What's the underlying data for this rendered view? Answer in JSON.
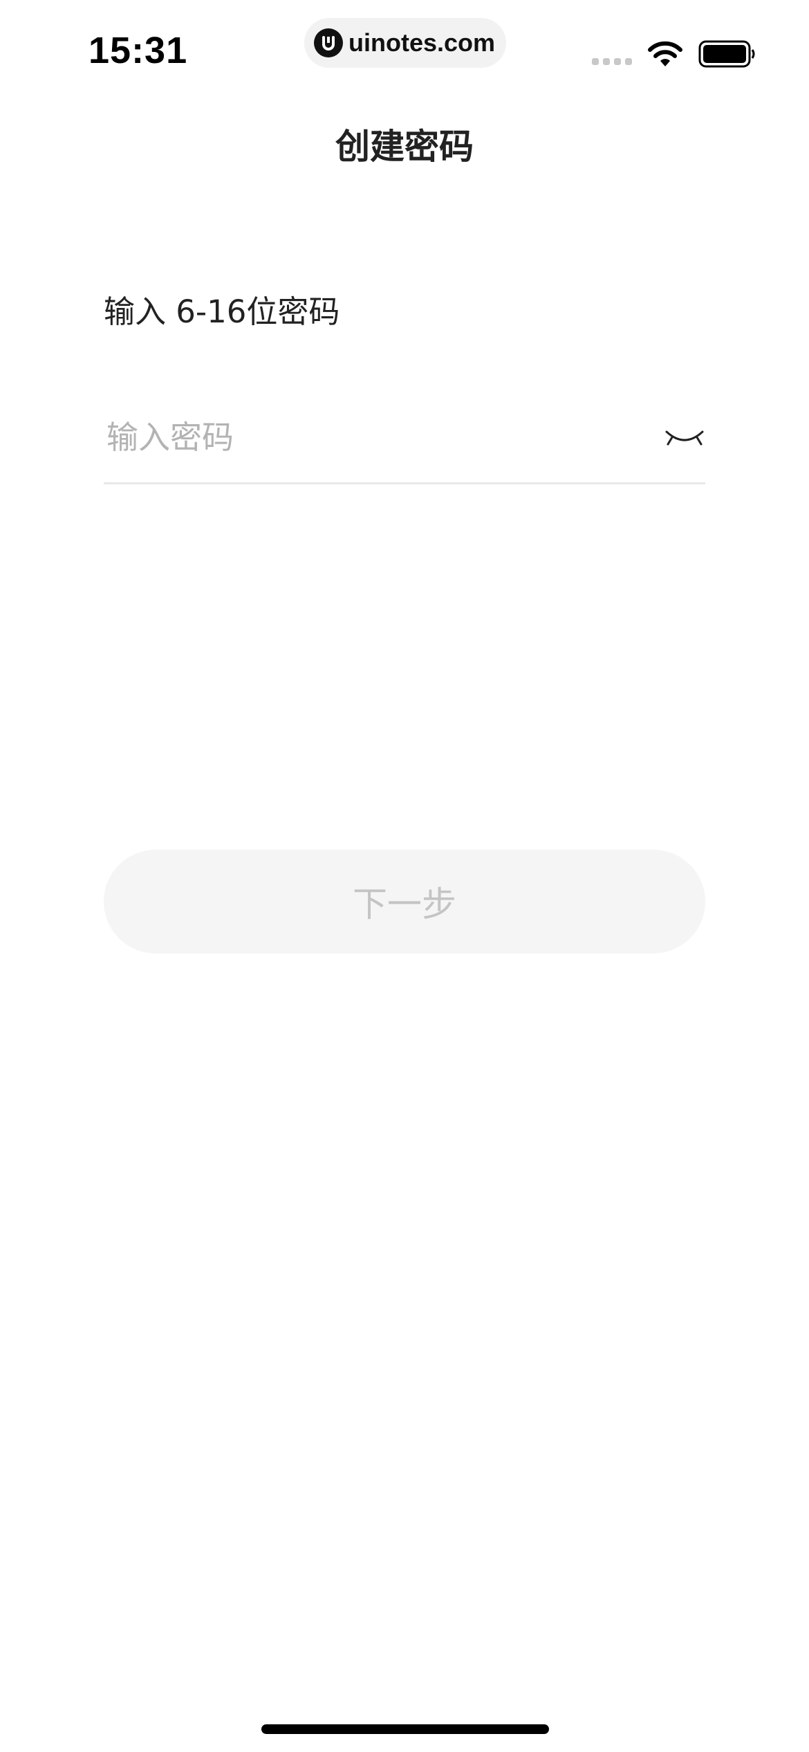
{
  "status_bar": {
    "time": "15:31",
    "url": "uinotes.com",
    "icons": [
      "signal-icon",
      "wifi-icon",
      "battery-icon"
    ]
  },
  "header": {
    "title": "创建密码"
  },
  "form": {
    "hint": "输入 6-16位密码",
    "password": {
      "value": "",
      "placeholder": "输入密码",
      "toggle_icon": "eye-closed-icon"
    },
    "next_label": "下一步"
  },
  "colors": {
    "background": "#ffffff",
    "text": "#222222",
    "placeholder": "#b3b3b3",
    "button_bg": "#f5f5f5",
    "button_text_disabled": "#c4c4c4",
    "divider": "#e8e8e8"
  }
}
